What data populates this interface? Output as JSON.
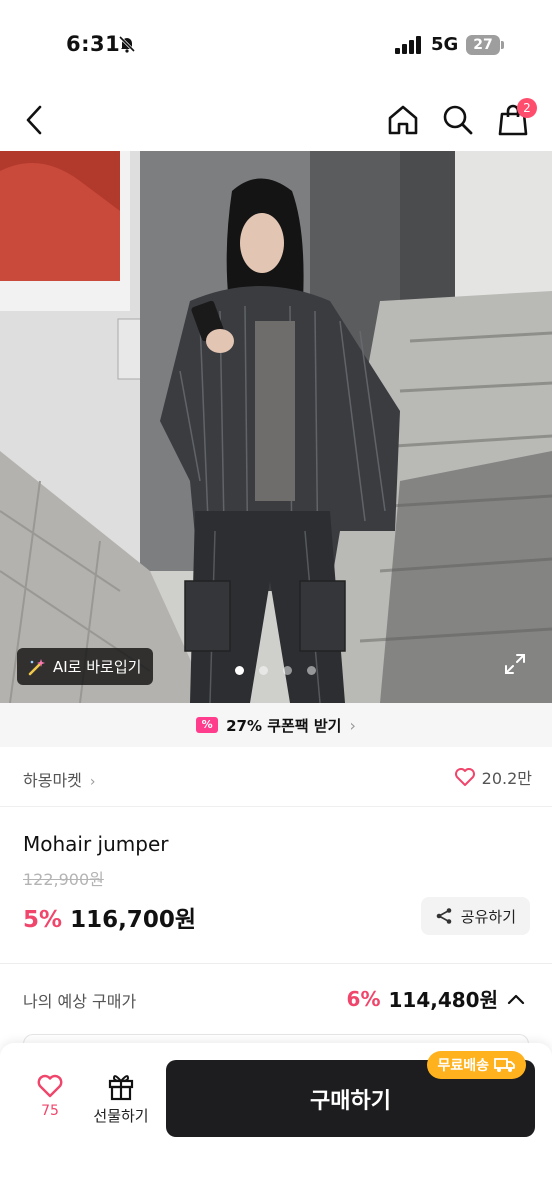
{
  "status_bar": {
    "time": "6:31",
    "network": "5G",
    "battery": "27"
  },
  "nav": {
    "cart_count": "2"
  },
  "gallery": {
    "ai_button_label": "AI로 바로입기",
    "image_count": 4,
    "active_index": 0
  },
  "coupon": {
    "label": "27% 쿠폰팩 받기"
  },
  "store": {
    "name": "하몽마켓",
    "likes": "20.2만"
  },
  "product": {
    "title": "Mohair jumper",
    "original_price": "122,900원",
    "discount": "5%",
    "price": "116,700",
    "price_unit": "원",
    "share_label": "공유하기"
  },
  "estimate": {
    "label": "나의 예상 구매가",
    "discount": "6%",
    "price": "114,480원"
  },
  "bottom_bar": {
    "wish_count": "75",
    "gift_label": "선물하기",
    "buy_label": "구매하기",
    "free_shipping_label": "무료배송"
  },
  "colors": {
    "accent_pink": "#f0466b",
    "badge": "#ff4d6d",
    "free_ship": "#ffb21d",
    "buy_button": "#1d1d1f"
  }
}
